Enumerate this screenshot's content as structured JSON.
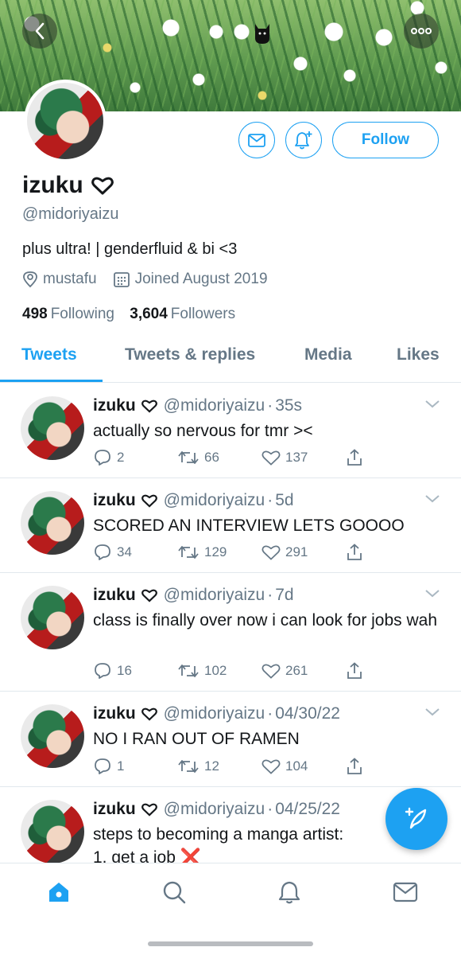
{
  "profile": {
    "name": "izuku",
    "handle": "@midoriyaizu",
    "bio": "plus ultra! | genderfluid & bi <3",
    "location": "mustafu",
    "joined": "Joined August 2019",
    "following_count": "498",
    "following_label": "Following",
    "followers_count": "3,604",
    "followers_label": "Followers",
    "follow_label": "Follow"
  },
  "tabs": [
    {
      "label": "Tweets",
      "active": true
    },
    {
      "label": "Tweets & replies",
      "active": false
    },
    {
      "label": "Media",
      "active": false
    },
    {
      "label": "Likes",
      "active": false
    }
  ],
  "tweets": [
    {
      "name": "izuku",
      "handle": "@midoriyaizu",
      "time": "35s",
      "text": "actually so nervous for tmr ><",
      "replies": "2",
      "retweets": "66",
      "likes": "137"
    },
    {
      "name": "izuku",
      "handle": "@midoriyaizu",
      "time": "5d",
      "text": "SCORED AN INTERVIEW LETS GOOOO",
      "replies": "34",
      "retweets": "129",
      "likes": "291"
    },
    {
      "name": "izuku",
      "handle": "@midoriyaizu",
      "time": "7d",
      "text": "class is finally over now i can look for jobs wah",
      "replies": "16",
      "retweets": "102",
      "likes": "261"
    },
    {
      "name": "izuku",
      "handle": "@midoriyaizu",
      "time": "04/30/22",
      "text": "NO I RAN OUT OF RAMEN",
      "replies": "1",
      "retweets": "12",
      "likes": "104"
    },
    {
      "name": "izuku",
      "handle": "@midoriyaizu",
      "time": "04/25/22",
      "text": "steps to becoming a manga artist:\n1. get a job ❌",
      "replies": "",
      "retweets": "",
      "likes": ""
    }
  ],
  "colors": {
    "accent": "#1da1f2",
    "muted": "#657786",
    "text": "#14171a"
  },
  "icons": {
    "header": [
      "back-arrow-icon",
      "more-icon"
    ],
    "nav": [
      "home-icon",
      "search-icon",
      "notifications-icon",
      "messages-icon"
    ],
    "fab": "compose-tweet-icon"
  }
}
